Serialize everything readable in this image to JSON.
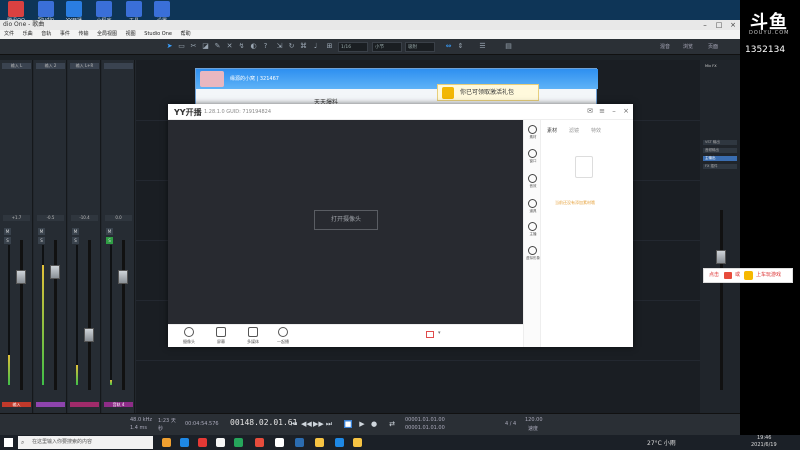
{
  "desktop": {
    "icons": [
      {
        "label": "腾讯QQ",
        "color": "#d94141"
      },
      {
        "label": "Studio",
        "color": "#3a6fd8"
      },
      {
        "label": "YY开播",
        "color": "#2a7de1"
      },
      {
        "label": "小程序",
        "color": "#3a6fd8"
      },
      {
        "label": "工具",
        "color": "#3a6fd8"
      },
      {
        "label": "设置",
        "color": "#3a6fd8"
      }
    ]
  },
  "studio": {
    "title": "dio One - 歌曲",
    "menu": [
      "文件",
      "乐曲",
      "音轨",
      "事件",
      "传输",
      "全局视图",
      "视图",
      "Studio One",
      "帮助"
    ],
    "toolbar": {
      "field1": "1/16",
      "field2": "小节",
      "field3": "吸附",
      "right_tabs": [
        "混音",
        "浏览",
        "页面"
      ]
    },
    "mixer": {
      "strips": [
        {
          "head": "输入 L",
          "label": "音轨 1",
          "level": "+1.7",
          "color_label": "输入",
          "color": "#c0392b"
        },
        {
          "head": "输入 2",
          "label": "音轨 2",
          "level": "-0.5",
          "color_label": "",
          "color": "#8e44ad"
        },
        {
          "head": "输入 L+R",
          "label": "音轨 3",
          "level": "-10.4",
          "color_label": "",
          "color": "#a02b6a"
        },
        {
          "head": "",
          "label": "音轨 4",
          "level": "0.0",
          "color_label": "音轨 4",
          "color": "#8e2c88"
        }
      ]
    },
    "right_panel": {
      "title": "Mix FX",
      "items": [
        "VST 输出",
        "音频输出",
        "主输出",
        "FX 插件"
      ]
    },
    "transport": {
      "sample_rate": "48.0 kHz",
      "latency": "1.4 ms",
      "time_label": "1:23 天",
      "time_sub": "秒",
      "position": "00:04:54.576",
      "bars": "00148.02.01.61",
      "loop_start": "00001.01.01.00",
      "loop_end": "00001.01.01.00",
      "signature": "4 / 4",
      "tempo": "120.00",
      "tempo_label": "速度"
    }
  },
  "qq_window": {
    "name": "缘源的小窝 | 321467",
    "tab": "天天爆料",
    "popup": "你已可领取激活礼包"
  },
  "yy": {
    "logo": "YY开播",
    "version": "1.28.1.0 GUID: 719194824",
    "open_camera": "打开摄像头",
    "bottom_buttons": [
      "摄像头",
      "屏幕",
      "多媒体",
      "一起播"
    ],
    "side_items": [
      "素材",
      "窗口",
      "音效",
      "道具",
      "主播",
      "虚拟形象"
    ],
    "right_tabs": [
      "素材",
      "滤镜",
      "特效"
    ],
    "empty_text": "当前还没有添加素材哦"
  },
  "douyu": {
    "logo": "斗鱼",
    "sub": "DOUYU.COM",
    "room_id": "1352134"
  },
  "ad_banner": {
    "text1": "点击",
    "text2": "或",
    "text3": "上车玩游戏"
  },
  "taskbar": {
    "search_placeholder": "在这里输入你要搜索的内容",
    "weather": "27°C 小雨",
    "time": "19:46",
    "date": "2021/6/19",
    "icons": [
      "#f0a030",
      "#1e88e5",
      "#e53935",
      "#f5f5f5",
      "#26a65b",
      "#ffffff",
      "#2b6cb0",
      "#f6c343"
    ]
  }
}
